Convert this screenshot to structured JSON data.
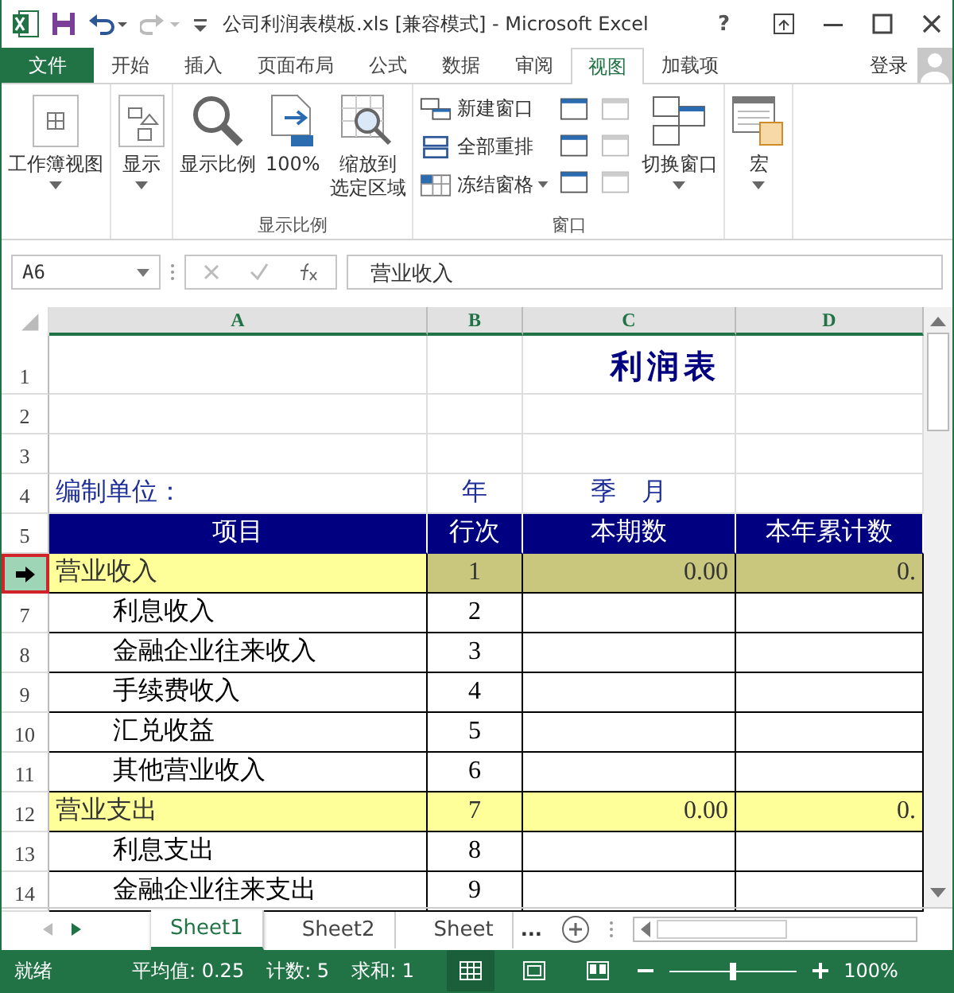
{
  "title_bar": {
    "title": "公司利润表模板.xls  [兼容模式] - Microsoft Excel",
    "help": "?"
  },
  "ribbon_tabs": [
    {
      "label": "文件",
      "kind": "file",
      "selected": false
    },
    {
      "label": "开始",
      "kind": "tab",
      "selected": false
    },
    {
      "label": "插入",
      "kind": "tab",
      "selected": false
    },
    {
      "label": "页面布局",
      "kind": "tab",
      "selected": false
    },
    {
      "label": "公式",
      "kind": "tab",
      "selected": false
    },
    {
      "label": "数据",
      "kind": "tab",
      "selected": false
    },
    {
      "label": "审阅",
      "kind": "tab",
      "selected": false
    },
    {
      "label": "视图",
      "kind": "tab",
      "selected": true
    },
    {
      "label": "加载项",
      "kind": "tab",
      "selected": false
    }
  ],
  "sign_in": "登录",
  "ribbon": {
    "groups": [
      {
        "items": [
          {
            "kind": "large",
            "lines": [
              "工作簿视图"
            ],
            "dropdown": true
          }
        ]
      },
      {
        "items": [
          {
            "kind": "large",
            "lines": [
              "显示"
            ],
            "dropdown": true
          }
        ]
      },
      {
        "label": "显示比例",
        "items": [
          {
            "kind": "large",
            "lines": [
              "显示比例"
            ],
            "dropdown": false
          },
          {
            "kind": "large",
            "lines": [
              "100%"
            ],
            "dropdown": false
          },
          {
            "kind": "large",
            "lines": [
              "缩放到",
              "选定区域"
            ],
            "dropdown": false
          }
        ]
      },
      {
        "label": "窗口",
        "items": [
          {
            "kind": "stack",
            "buttons": [
              {
                "label": "新建窗口",
                "dropdown": false
              },
              {
                "label": "全部重排",
                "dropdown": false
              },
              {
                "label": "冻结窗格",
                "dropdown": true
              }
            ]
          },
          {
            "kind": "icons",
            "buttons": [
              {
                "disabled": false
              },
              {
                "disabled": false
              },
              {
                "disabled": false
              }
            ]
          },
          {
            "kind": "icons",
            "buttons": [
              {
                "disabled": true
              },
              {
                "disabled": true
              },
              {
                "disabled": true
              }
            ]
          },
          {
            "kind": "large",
            "lines": [
              "切换窗口"
            ],
            "dropdown": true
          }
        ]
      },
      {
        "items": [
          {
            "kind": "large",
            "lines": [
              "宏"
            ],
            "dropdown": true
          }
        ]
      }
    ]
  },
  "formula_bar": {
    "name_box": "A6",
    "formula": "营业收入"
  },
  "sheet": {
    "columns": [
      "A",
      "B",
      "C",
      "D"
    ],
    "rows": [
      {
        "num": "1",
        "kind": "title",
        "selected": false,
        "cells": [
          "",
          "",
          "利润表",
          ""
        ]
      },
      {
        "num": "2",
        "kind": "blank",
        "selected": false,
        "cells": [
          "",
          "",
          "",
          ""
        ]
      },
      {
        "num": "3",
        "kind": "blank",
        "selected": false,
        "cells": [
          "",
          "",
          "",
          ""
        ]
      },
      {
        "num": "4",
        "kind": "info",
        "selected": false,
        "cells": [
          "编制单位：",
          "年",
          "季　月",
          ""
        ]
      },
      {
        "num": "5",
        "kind": "header",
        "selected": false,
        "cells": [
          "项目",
          "行次",
          "本期数",
          "本年累计数"
        ]
      },
      {
        "kind": "total",
        "selected": true,
        "cells": [
          "营业收入",
          "1",
          "0.00",
          "0."
        ]
      },
      {
        "num": "7",
        "kind": "item",
        "selected": false,
        "cells": [
          "利息收入",
          "2",
          "",
          ""
        ]
      },
      {
        "num": "8",
        "kind": "item",
        "selected": false,
        "cells": [
          "金融企业往来收入",
          "3",
          "",
          ""
        ]
      },
      {
        "num": "9",
        "kind": "item",
        "selected": false,
        "cells": [
          "手续费收入",
          "4",
          "",
          ""
        ]
      },
      {
        "num": "10",
        "kind": "item",
        "selected": false,
        "cells": [
          "汇兑收益",
          "5",
          "",
          ""
        ]
      },
      {
        "num": "11",
        "kind": "item",
        "selected": false,
        "cells": [
          "其他营业收入",
          "6",
          "",
          ""
        ]
      },
      {
        "num": "12",
        "kind": "total",
        "selected": false,
        "cells": [
          "营业支出",
          "7",
          "0.00",
          "0."
        ]
      },
      {
        "num": "13",
        "kind": "item",
        "selected": false,
        "cells": [
          "利息支出",
          "8",
          "",
          ""
        ]
      },
      {
        "num": "14",
        "kind": "item",
        "selected": false,
        "cells": [
          "金融企业往来支出",
          "9",
          "",
          ""
        ]
      }
    ]
  },
  "sheet_tabs": [
    {
      "label": "Sheet1",
      "selected": true
    },
    {
      "label": "Sheet2",
      "selected": false
    },
    {
      "label": "Sheet",
      "selected": false
    }
  ],
  "more_sheets": "...",
  "status_bar": {
    "mode": "就绪",
    "stats": [
      "平均值: 0.25",
      "计数: 5",
      "求和: 1"
    ],
    "views": [
      {
        "selected": true
      },
      {
        "selected": false
      },
      {
        "selected": false
      }
    ],
    "zoom": {
      "level": 0.5,
      "reading": "100%"
    }
  }
}
